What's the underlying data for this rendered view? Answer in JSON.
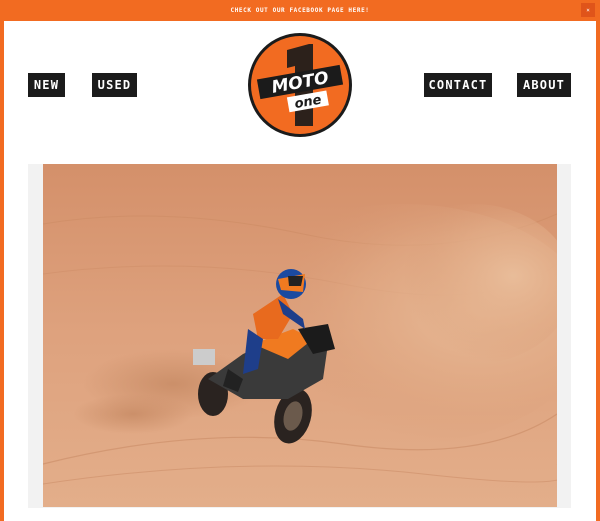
{
  "announcement": {
    "text": "CHECK OUT OUR FACEBOOK PAGE HERE!",
    "close_glyph": "×"
  },
  "nav": {
    "new": "NEW",
    "used": "USED",
    "contact": "CONTACT",
    "about": "ABOUT"
  },
  "logo": {
    "line1": "MOTO",
    "line2": "one",
    "background_number": "1"
  },
  "colors": {
    "brand_orange": "#f26b21",
    "dark": "#1b1b1b",
    "white": "#ffffff"
  },
  "hero": {
    "icon": "dirt-bike-desert-photo"
  }
}
